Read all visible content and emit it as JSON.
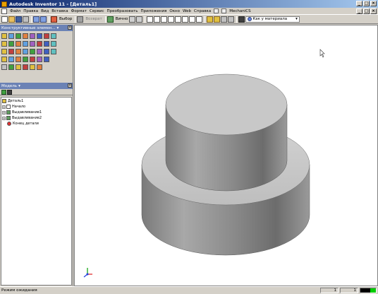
{
  "window": {
    "title": "Autodesk Inventor 11 - [Деталь1]"
  },
  "menu": {
    "items": [
      "Файл",
      "Правка",
      "Вид",
      "Вставка",
      "Формат",
      "Сервис",
      "Преобразовать",
      "Приложения",
      "Окно",
      "Web",
      "Справка"
    ],
    "mechanics_label": "MechaniCS"
  },
  "toolbar": {
    "select_label": "Выбор",
    "return_label": "Возврат",
    "all_label": "Вично",
    "material_combo": "Как у материала"
  },
  "panels": {
    "features_title": "Конструктивные элемен...",
    "browser_title": "Модель"
  },
  "tree": {
    "items": [
      {
        "label": "Деталь1",
        "level": 0,
        "icon": "part-icon",
        "expander": ""
      },
      {
        "label": "Начало",
        "level": 1,
        "icon": "folder-icon",
        "expander": "+"
      },
      {
        "label": "Выдавливание1",
        "level": 1,
        "icon": "extrude-icon",
        "expander": "+"
      },
      {
        "label": "Выдавливание2",
        "level": 1,
        "icon": "extrude-icon",
        "expander": "+"
      },
      {
        "label": "Конец детали",
        "level": 1,
        "icon": "end-of-part-icon",
        "expander": ""
      }
    ]
  },
  "status": {
    "text": "Режим ожидания",
    "cell1": "1",
    "cell2": "1"
  },
  "colors": {
    "title_start": "#0a246a",
    "title_end": "#a6caf0",
    "panel_header": "#6b82b5",
    "status_green": "#00cc00"
  }
}
